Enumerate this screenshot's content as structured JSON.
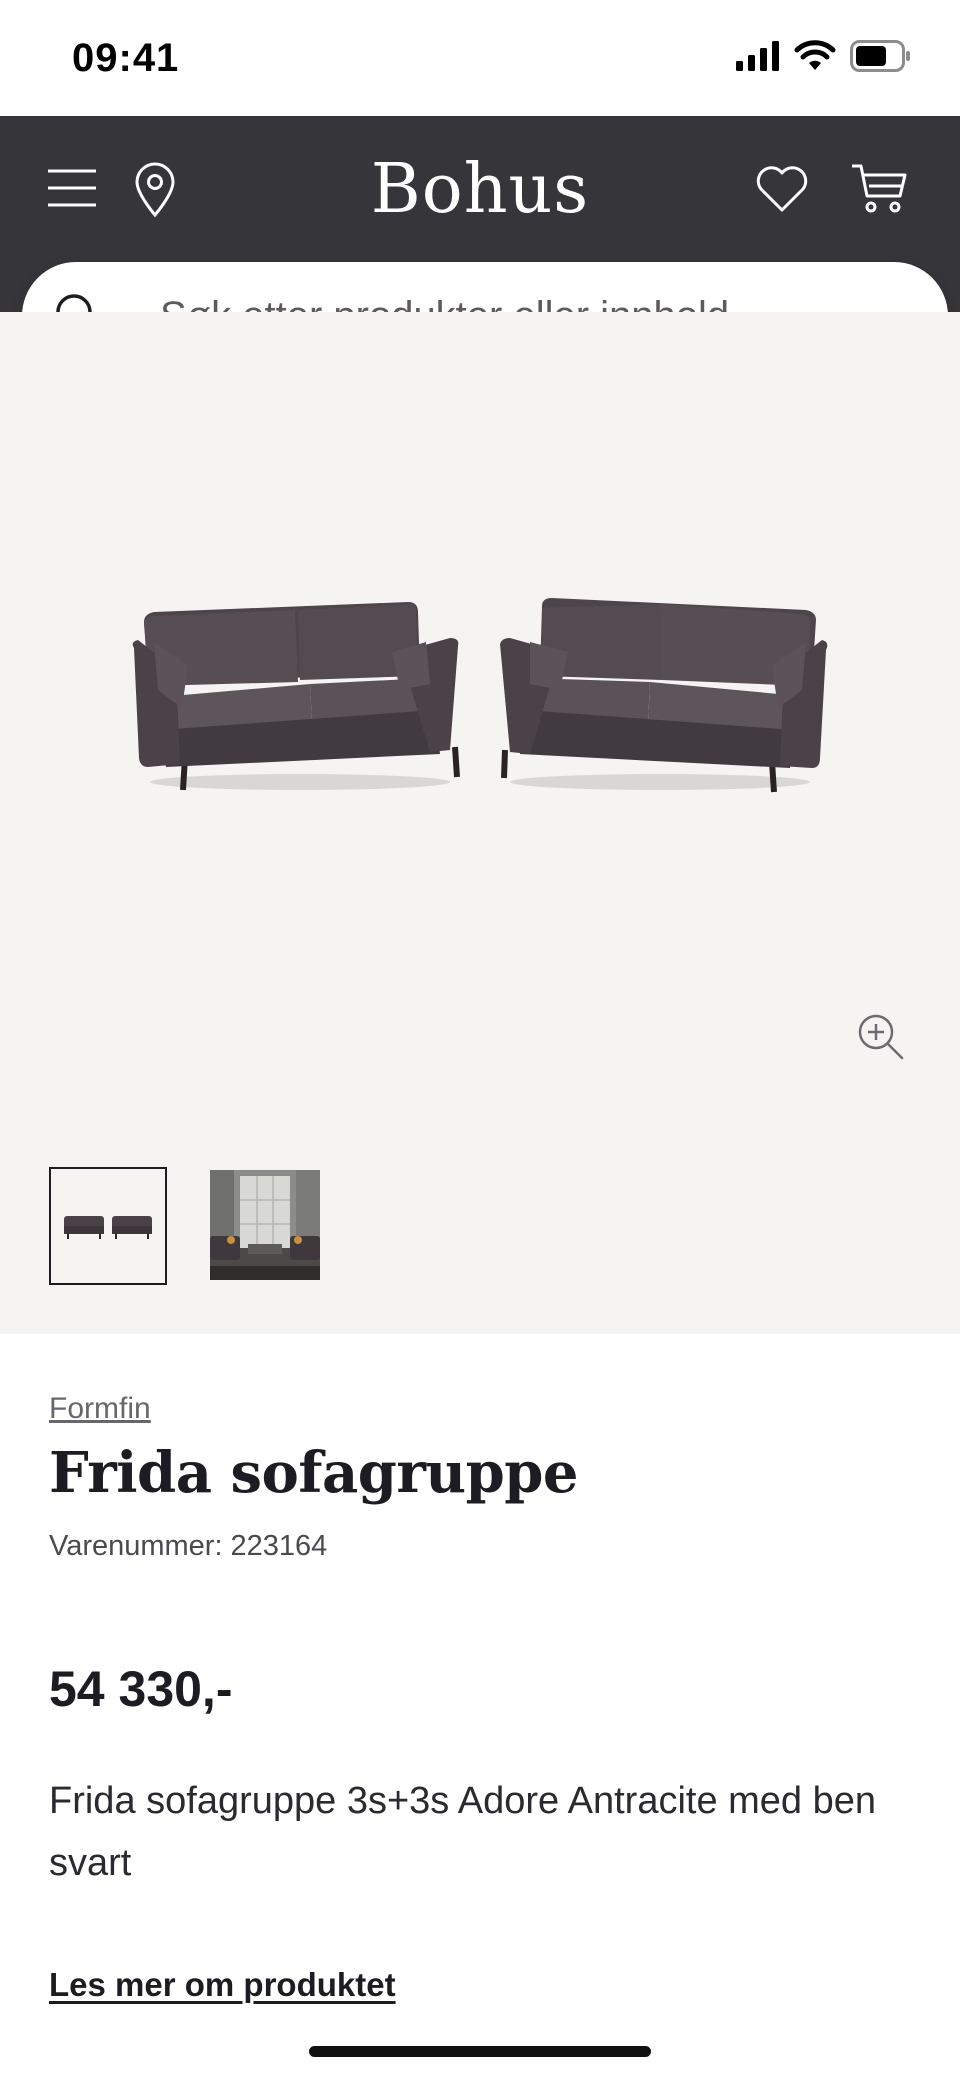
{
  "status_bar": {
    "time": "09:41"
  },
  "header": {
    "logo": "Bohus",
    "icons": [
      "menu-icon",
      "location-pin-icon",
      "heart-icon",
      "cart-icon"
    ]
  },
  "search": {
    "placeholder": "Søk etter produkter eller innhold ..."
  },
  "gallery": {
    "thumbnails": [
      "sofa-pair-thumbnail",
      "room-scene-thumbnail"
    ],
    "selected_thumbnail": 1
  },
  "product": {
    "brand": "Formfin",
    "title": "Frida sofagruppe",
    "sku_label": "Varenummer:",
    "sku_value": "223164",
    "price": "54 330,-",
    "description": "Frida sofagruppe 3s+3s Adore Antracite med ben svart",
    "read_more": "Les mer om produktet"
  },
  "colors": {
    "header_bg": "#36363a",
    "gallery_bg": "#f5f4f2",
    "text": "#1c1c22",
    "sofa": "#4a4247"
  }
}
